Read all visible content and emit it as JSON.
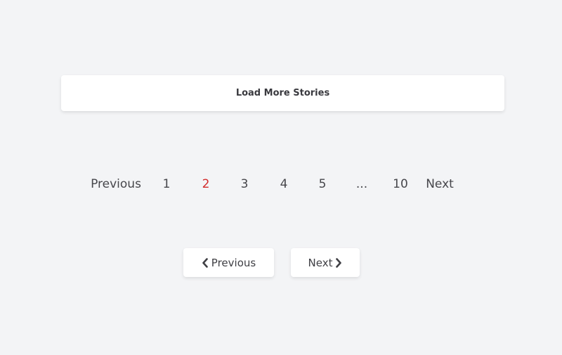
{
  "load_more": {
    "label": "Load More Stories"
  },
  "pagination": {
    "previous_label": "Previous",
    "pages": [
      "1",
      "2",
      "3",
      "4",
      "5"
    ],
    "ellipsis": "...",
    "last_page": "10",
    "next_label": "Next",
    "current_page": "2",
    "active_color": "#d22b2b"
  },
  "simple_pager": {
    "previous_label": "Previous",
    "next_label": "Next",
    "previous_icon": "chevron-left-icon",
    "next_icon": "chevron-right-icon"
  }
}
